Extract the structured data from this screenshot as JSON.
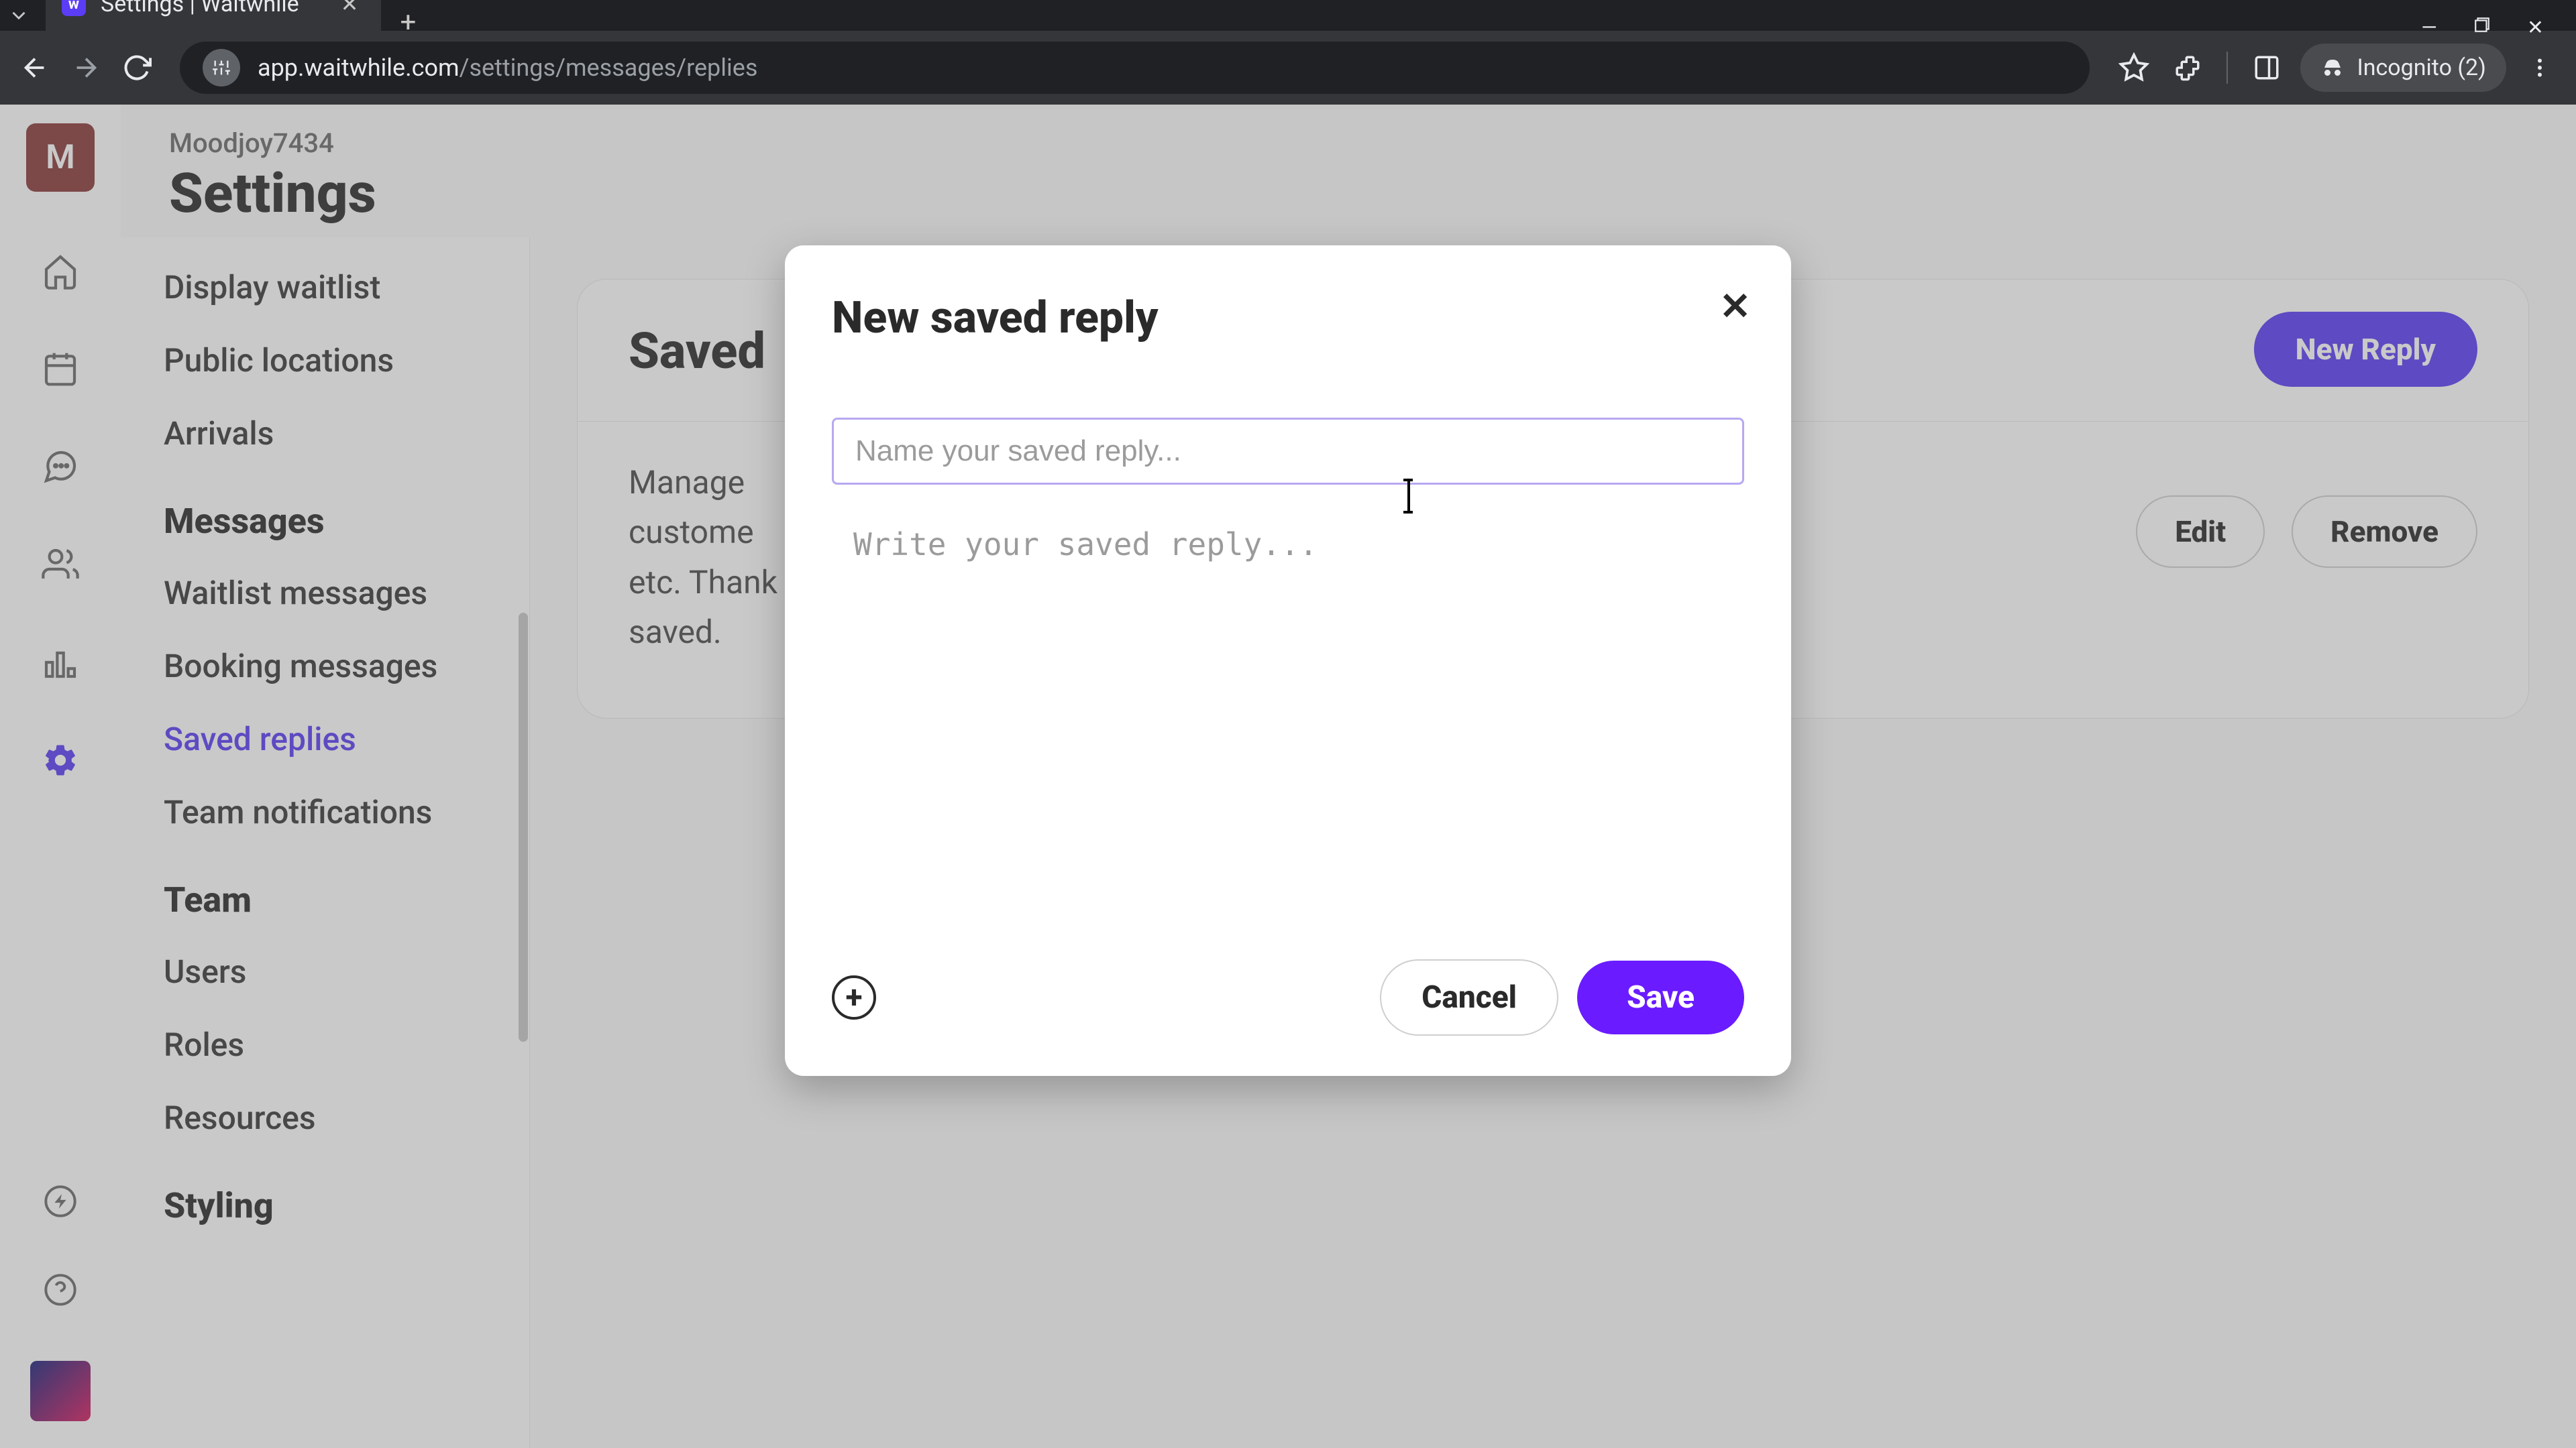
{
  "browser": {
    "tab_title": "Settings | Waitwhile",
    "favicon_letter": "w",
    "url_host": "app.waitwhile.com",
    "url_path": "/settings/messages/replies",
    "incognito_label": "Incognito (2)"
  },
  "header": {
    "org": "Moodjoy7434",
    "title": "Settings",
    "avatar_letter": "M"
  },
  "sidebar": {
    "items_top": [
      "Display waitlist",
      "Public locations",
      "Arrivals"
    ],
    "section_messages": "Messages",
    "messages_items": [
      "Waitlist messages",
      "Booking messages",
      "Saved replies",
      "Team notifications"
    ],
    "messages_active_index": 2,
    "section_team": "Team",
    "team_items": [
      "Users",
      "Roles",
      "Resources"
    ],
    "section_styling": "Styling"
  },
  "main": {
    "card_title": "Saved",
    "new_reply_button": "New Reply",
    "description_line1": "Manage",
    "description_line2": "custome",
    "description_line3": "saved.",
    "description_tail": " etc. Thank",
    "edit_button": "Edit",
    "remove_button": "Remove"
  },
  "modal": {
    "title": "New saved reply",
    "name_placeholder": "Name your saved reply...",
    "body_placeholder": "Write your saved reply...",
    "cancel": "Cancel",
    "save": "Save"
  }
}
